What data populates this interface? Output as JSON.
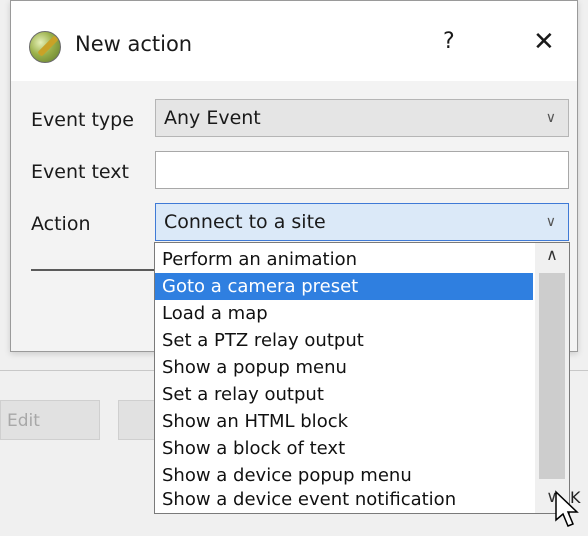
{
  "background": {
    "edit_button": "Edit",
    "ok_fragment": "K"
  },
  "dialog": {
    "title": "New action",
    "help_label": "?",
    "close_label": "✕",
    "event_type_label": "Event type",
    "event_type_value": "Any Event",
    "event_text_label": "Event text",
    "event_text_value": "",
    "action_label": "Action",
    "action_value": "Connect to a site"
  },
  "dropdown": {
    "selected_index": 1,
    "items": [
      "Perform an animation",
      "Goto a camera preset",
      "Load a map",
      "Set a PTZ relay output",
      "Show a popup menu",
      "Set a relay output",
      "Show an HTML block",
      "Show a block of text",
      "Show a device popup menu",
      "Show a device event notification"
    ]
  },
  "colors": {
    "selection": "#2f7fe0",
    "active_combo": "#dbe9f8",
    "active_border": "#3f7ad6"
  }
}
